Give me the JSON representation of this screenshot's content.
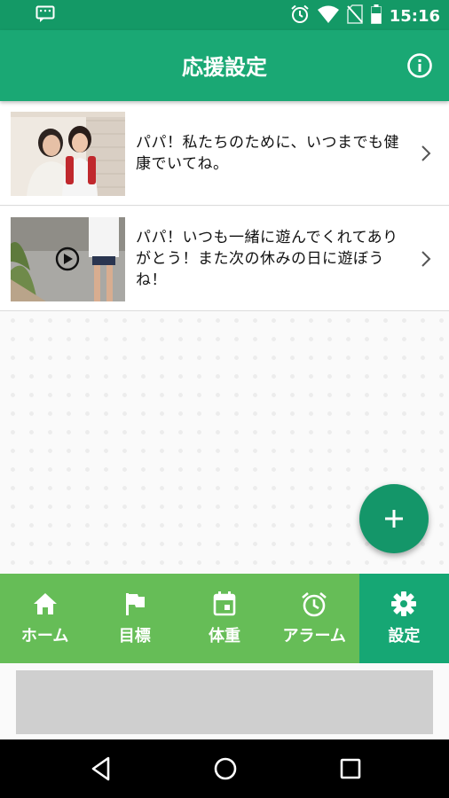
{
  "status_bar": {
    "time": "15:16",
    "icons": [
      "message-icon",
      "alarm-icon",
      "wifi-icon",
      "no-sim-icon",
      "battery-icon"
    ]
  },
  "app_bar": {
    "title": "応援設定",
    "info_icon": "info-icon"
  },
  "list": {
    "items": [
      {
        "text": "パパ！私たちのために、いつまでも健康でいてね。",
        "media": "photo",
        "thumbnail": "mother-and-daughter-photo"
      },
      {
        "text": "パパ！いつも一緒に遊んでくれてありがとう！また次の休みの日に遊ぼうね！",
        "media": "video",
        "thumbnail": "child-walking-video"
      }
    ]
  },
  "fab": {
    "icon": "plus-icon"
  },
  "bottom_nav": {
    "items": [
      {
        "label": "ホーム",
        "icon": "home-icon",
        "active": false
      },
      {
        "label": "目標",
        "icon": "flag-icon",
        "active": false
      },
      {
        "label": "体重",
        "icon": "calendar-icon",
        "active": false
      },
      {
        "label": "アラーム",
        "icon": "alarm-clock-icon",
        "active": false
      },
      {
        "label": "設定",
        "icon": "gear-icon",
        "active": true
      }
    ]
  },
  "colors": {
    "status_bar": "#149966",
    "app_bar": "#1aa874",
    "nav_bg": "#66bd57",
    "nav_active": "#16a774",
    "fab": "#149669"
  }
}
